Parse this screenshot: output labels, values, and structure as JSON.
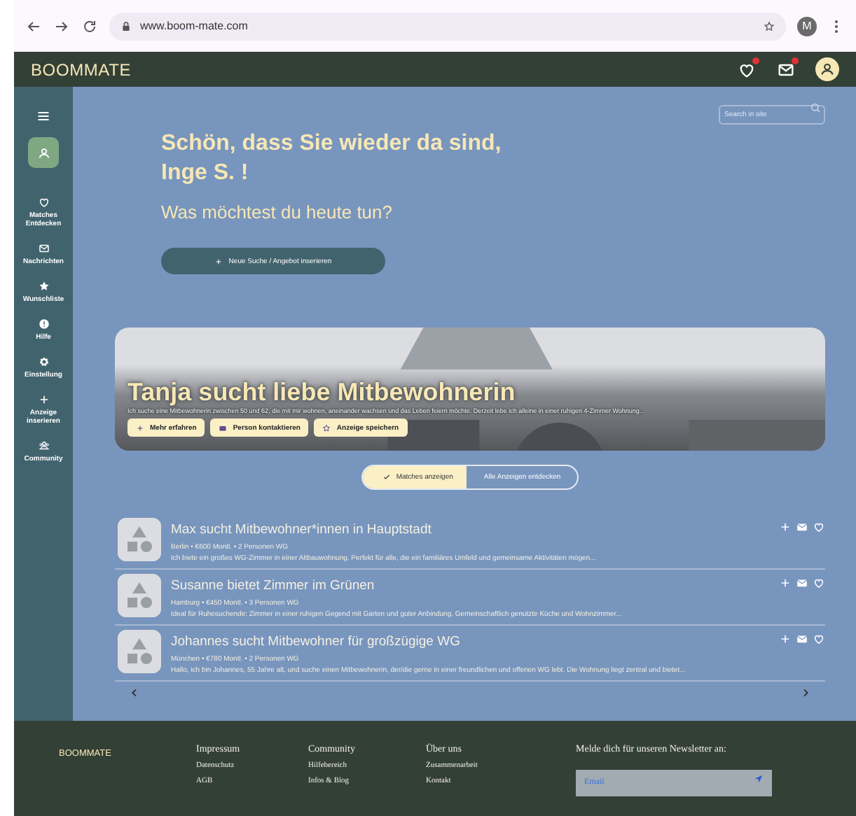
{
  "browser": {
    "url": "www.boom-mate.com",
    "profile": "M"
  },
  "header": {
    "logo": "BOOMMATE"
  },
  "sidebar": {
    "items": [
      {
        "kind": "heart",
        "label": "Matches Entdecken"
      },
      {
        "kind": "mail",
        "label": "Nachrichten"
      },
      {
        "kind": "star",
        "label": "Wunschliste"
      },
      {
        "kind": "info",
        "label": "Hilfe"
      },
      {
        "kind": "gear",
        "label": "Einstellung"
      },
      {
        "kind": "plus",
        "label": "Anzeige inserieren"
      },
      {
        "kind": "people",
        "label": "Community"
      }
    ]
  },
  "search": {
    "placeholder": "Search in site"
  },
  "greeting": {
    "title": "Schön, dass Sie wieder da sind, Inge S. !",
    "subtitle": "Was möchtest du heute tun?",
    "button": "Neue Suche / Angebot inserieren"
  },
  "featured": {
    "title": "Tanja sucht liebe Mitbewohnerin",
    "description": "Ich suche eine Mitbewohnerin zwischen 50 und 62, die mit mir wohnen, aneinander wachsen und das Leben feiern möchte. Derzeit lebe ich alleine in einer ruhigen 4-Zimmer Wohnung...",
    "buttons": [
      {
        "kind": "plus",
        "label": "Mehr erfahren"
      },
      {
        "kind": "mail",
        "label": "Person kontaktieren"
      },
      {
        "kind": "star",
        "label": "Anzeige speichern"
      }
    ]
  },
  "toggle": [
    {
      "label": "Matches anzeigen",
      "selected": true
    },
    {
      "label": "Alle Anzeigen entdecken",
      "selected": false
    }
  ],
  "listings": [
    {
      "title": "Max sucht Mitbewohner*innen in Hauptstadt",
      "meta": "Berlin • €600 Montl. •  2 Personen WG",
      "description": "Ich biete ein großes WG-Zimmer in einer Altbauwohnung. Perfekt für alle, die ein familiäres Umfeld und gemeinsame Aktivitäten mögen..."
    },
    {
      "title": "Susanne bietet Zimmer im Grünen",
      "meta": "Hamburg • €450 Montl. •  3 Personen WG",
      "description": "Ideal für Ruhesuchende: Zimmer in einer ruhigen Gegend mit Garten und guter Anbindung. Gemeinschaftlich genutzte Küche und Wohnzimmer..."
    },
    {
      "title": "Johannes sucht Mitbewohner für großzügige WG",
      "meta": "München • €780 Montl. • 2 Personen WG",
      "description": "Hallo, ich bin Johannes, 55 Jahre alt, und suche einen Mitbewohnerin, der/die gerne in einer freundlichen und offenen WG lebt. Die Wohnung liegt zentral und bietet..."
    }
  ],
  "footer": {
    "logo": "BOOMMATE",
    "columns": [
      {
        "heading": "Impressum",
        "links": [
          "Datenschutz",
          "AGB"
        ]
      },
      {
        "heading": "Community",
        "links": [
          "Hilfebereich",
          "Infos & Blog"
        ]
      },
      {
        "heading": "Über uns",
        "links": [
          "Zusammenarbeit",
          "Kontakt"
        ]
      }
    ],
    "newsletter": {
      "label": "Melde dich für unseren Newsletter an:",
      "placeholder": "Email"
    }
  }
}
